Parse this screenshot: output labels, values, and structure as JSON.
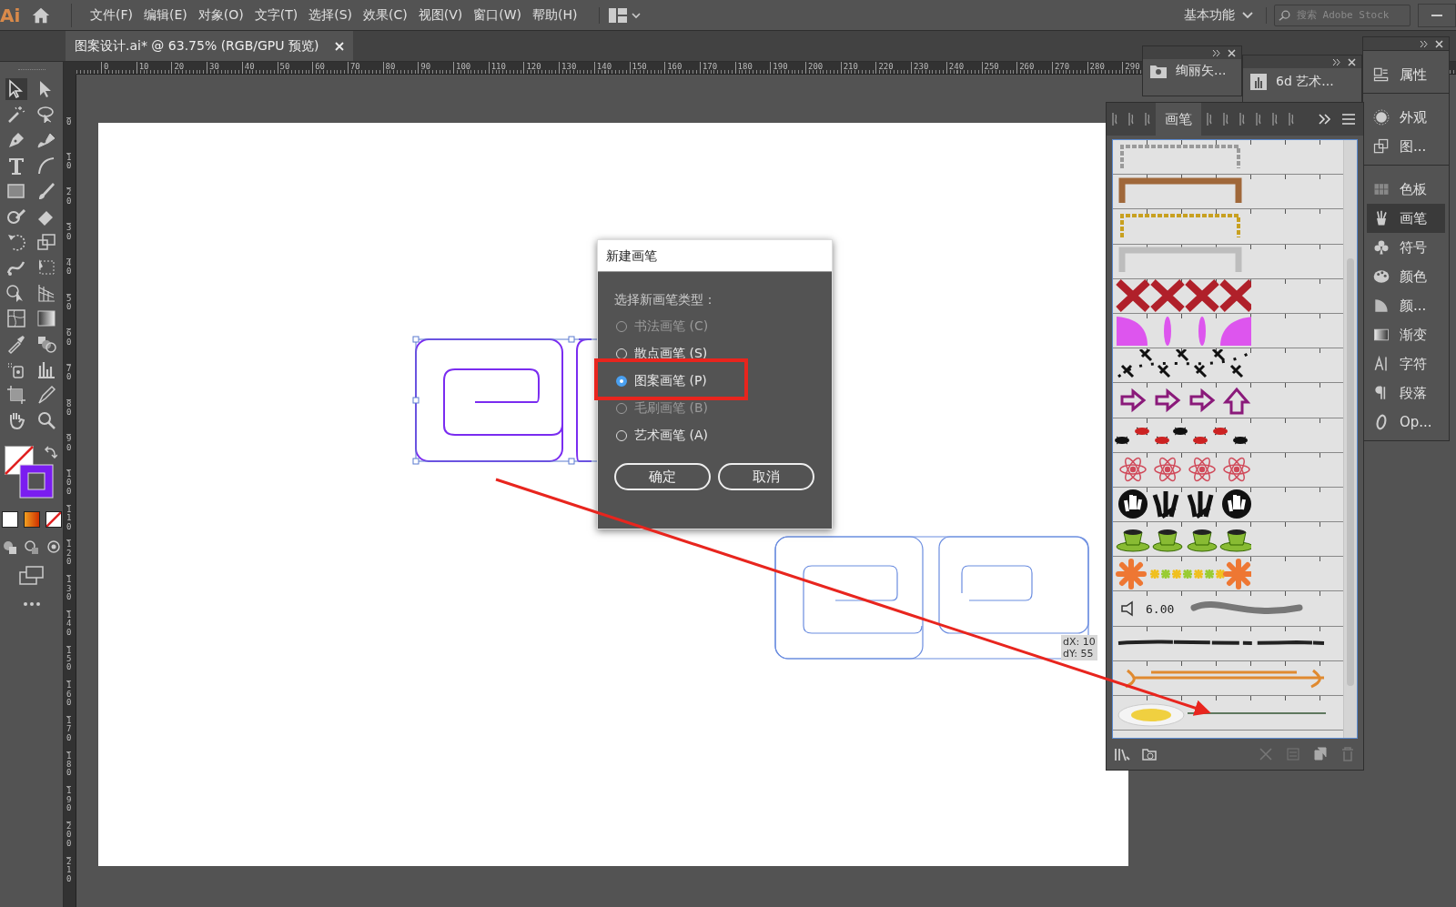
{
  "app": {
    "logo": "Ai"
  },
  "menu": [
    "文件(F)",
    "编辑(E)",
    "对象(O)",
    "文字(T)",
    "选择(S)",
    "效果(C)",
    "视图(V)",
    "窗口(W)",
    "帮助(H)"
  ],
  "workspace": {
    "label": "基本功能"
  },
  "search": {
    "placeholder": "搜索 Adobe Stock"
  },
  "document_tab": {
    "title": "图案设计.ai* @ 63.75% (RGB/GPU 预览)",
    "selected": true
  },
  "rulers": {
    "horizontal": [
      "0",
      "10",
      "20",
      "30",
      "40",
      "50",
      "60",
      "70",
      "80",
      "90",
      "100",
      "110",
      "120",
      "130",
      "140",
      "150",
      "160",
      "170",
      "180",
      "190",
      "200",
      "210",
      "220",
      "230",
      "240",
      "250",
      "260",
      "270",
      "280",
      "290"
    ],
    "vertical": [
      "0",
      "10",
      "20",
      "30",
      "40",
      "50",
      "60",
      "70",
      "80",
      "90",
      "100",
      "110",
      "120",
      "130",
      "140",
      "150",
      "160",
      "170",
      "180",
      "190",
      "200",
      "210"
    ]
  },
  "canvas": {
    "measure": [
      "dX: 10",
      "dY: 55"
    ]
  },
  "collapsed_panels": [
    {
      "label": "绚丽矢..."
    },
    {
      "label": "6d 艺术..."
    }
  ],
  "dock": [
    {
      "items": [
        {
          "label": "属性",
          "selected": false
        }
      ]
    },
    {
      "items": [
        {
          "label": "外观",
          "selected": false
        },
        {
          "label": "图...",
          "selected": false
        }
      ]
    },
    {
      "items": [
        {
          "label": "色板",
          "selected": false
        },
        {
          "label": "画笔",
          "selected": true
        },
        {
          "label": "符号",
          "selected": false
        },
        {
          "label": "颜色",
          "selected": false
        },
        {
          "label": "颜...",
          "selected": false
        },
        {
          "label": "渐变",
          "selected": false
        },
        {
          "label": "字符",
          "selected": false
        },
        {
          "label": "段落",
          "selected": false
        },
        {
          "label": "Op...",
          "selected": false
        }
      ]
    }
  ],
  "brushes_panel": {
    "tabs": [
      {
        "selected": false
      },
      {
        "selected": false
      },
      {
        "selected": false
      },
      {
        "label": "画笔",
        "selected": true
      },
      {
        "selected": false
      },
      {
        "selected": false
      },
      {
        "selected": false
      },
      {
        "selected": false
      },
      {
        "selected": false
      },
      {
        "selected": false
      }
    ],
    "brushes": [
      {
        "kind": "frame",
        "color": "#9a9a9a"
      },
      {
        "kind": "frame",
        "color": "#a0683a"
      },
      {
        "kind": "frame",
        "color": "#c8a020"
      },
      {
        "kind": "frame",
        "color": "#bdbdbd"
      },
      {
        "kind": "x-mark",
        "color": "#b0202a"
      },
      {
        "kind": "petal",
        "color": "#dd55ee"
      },
      {
        "kind": "stitch",
        "color": "#111111"
      },
      {
        "kind": "arrow",
        "color": "#8a1a7a"
      },
      {
        "kind": "bug",
        "color": "#cc2222"
      },
      {
        "kind": "atom",
        "color": "#d04a5a"
      },
      {
        "kind": "hand",
        "color": "#111111"
      },
      {
        "kind": "cup",
        "color": "#88bb33"
      },
      {
        "kind": "flower",
        "color": "#ee7733"
      },
      {
        "kind": "calligraphic",
        "color": "#777777",
        "size": "6.00"
      },
      {
        "kind": "charcoal",
        "color": "#222222"
      },
      {
        "kind": "arrow-line",
        "color": "#e08a30"
      },
      {
        "kind": "daisy",
        "color": "#f0d040"
      }
    ]
  },
  "dialog": {
    "title": "新建画笔",
    "prompt": "选择新画笔类型：",
    "options": [
      {
        "label": "书法画笔 (C)",
        "selected": false,
        "disabled": true
      },
      {
        "label": "散点画笔 (S)",
        "selected": false,
        "disabled": false
      },
      {
        "label": "图案画笔 (P)",
        "selected": true,
        "disabled": false
      },
      {
        "label": "毛刷画笔 (B)",
        "selected": false,
        "disabled": true
      },
      {
        "label": "艺术画笔 (A)",
        "selected": false,
        "disabled": false
      }
    ],
    "buttons": [
      "确定",
      "取消"
    ]
  }
}
